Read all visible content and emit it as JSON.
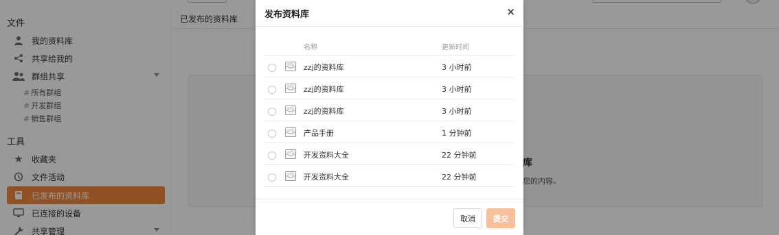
{
  "sidebar": {
    "files_section": "文件",
    "tools_section": "工具",
    "items": [
      {
        "label": "我的资料库",
        "icon": "user-icon"
      },
      {
        "label": "共享给我的",
        "icon": "share-icon"
      },
      {
        "label": "群组共享",
        "icon": "group-icon"
      },
      {
        "label": "收藏夹",
        "icon": "star-icon"
      },
      {
        "label": "文件活动",
        "icon": "history-icon"
      },
      {
        "label": "已发布的资料库",
        "icon": "book-icon"
      },
      {
        "label": "已连接的设备",
        "icon": "monitor-icon"
      },
      {
        "label": "共享管理",
        "icon": "wrench-icon"
      }
    ],
    "groups": [
      "所有群组",
      "开发群组",
      "销售群组"
    ],
    "active_item": "已发布的资料库",
    "accent_color": "#f0873d"
  },
  "main": {
    "title": "已发布的资料库",
    "empty_title": "库",
    "empty_desc": "您的内容。"
  },
  "modal": {
    "title": "发布资料库",
    "close_glyph": "×",
    "columns": {
      "name": "名称",
      "updated": "更新时间"
    },
    "rows": [
      {
        "name": "zzj的资料库",
        "time": "3 小时前"
      },
      {
        "name": "zzj的资料库",
        "time": "3 小时前"
      },
      {
        "name": "zzj的资料库",
        "time": "3 小时前"
      },
      {
        "name": "产品手册",
        "time": "1 分钟前"
      },
      {
        "name": "开发资料大全",
        "time": "22 分钟前"
      },
      {
        "name": "开发资料大全",
        "time": "22 分钟前"
      }
    ],
    "cancel_label": "取消",
    "submit_label": "提交",
    "submit_color": "#f8c09a"
  }
}
